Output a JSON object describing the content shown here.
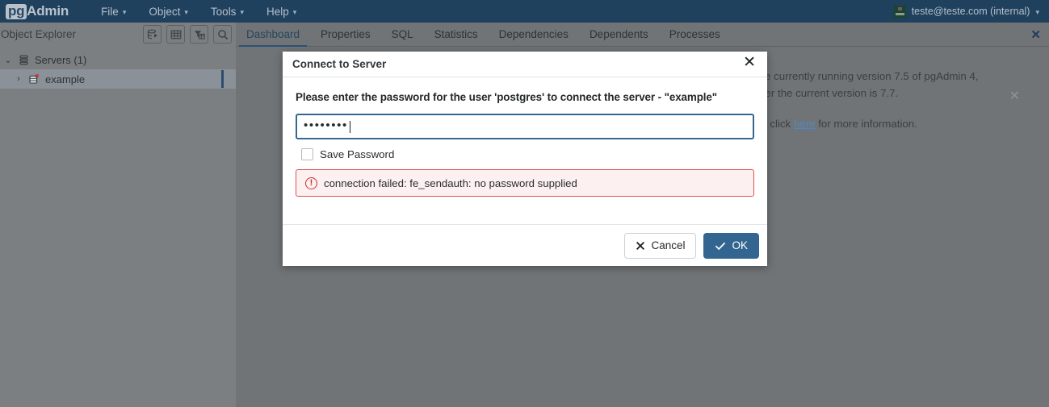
{
  "navbar": {
    "brand_pg": "pg",
    "brand_admin": "Admin",
    "menus": [
      {
        "label": "File",
        "icon": "chevron-down-icon"
      },
      {
        "label": "Object",
        "icon": "chevron-down-icon"
      },
      {
        "label": "Tools",
        "icon": "chevron-down-icon"
      },
      {
        "label": "Help",
        "icon": "chevron-down-icon"
      }
    ],
    "user": "teste@teste.com (internal)",
    "user_caret": "⌄"
  },
  "object_explorer": {
    "title": "Object Explorer",
    "tools": [
      {
        "name": "add-server-icon"
      },
      {
        "name": "table-grid-icon"
      },
      {
        "name": "filter-table-icon"
      },
      {
        "name": "search-icon"
      }
    ],
    "tree": [
      {
        "label": "Servers (1)",
        "chevron": "⌄",
        "icon": "servers-icon",
        "selected": false
      },
      {
        "label": "example",
        "chevron": "›",
        "icon": "server-disconnected-icon",
        "selected": true
      }
    ]
  },
  "tabs": {
    "items": [
      {
        "label": "Dashboard",
        "active": true
      },
      {
        "label": "Properties",
        "active": false
      },
      {
        "label": "SQL",
        "active": false
      },
      {
        "label": "Statistics",
        "active": false
      },
      {
        "label": "Dependencies",
        "active": false
      },
      {
        "label": "Dependents",
        "active": false
      },
      {
        "label": "Processes",
        "active": false
      }
    ],
    "close_label": "✕"
  },
  "notification": {
    "line1": "You are currently running version 7.5 of pgAdmin 4, however the current version is 7.7.",
    "line2_prefix": "Please click ",
    "link": "here",
    "line2_suffix": " for more information.",
    "close_label": "✕",
    "ghost_label": "Dashboard"
  },
  "dialog": {
    "title": "Connect to Server",
    "close_label": "✕",
    "message": "Please enter the password for the user 'postgres' to connect the server - \"example\"",
    "password_value": "••••••••",
    "password_placeholder": "",
    "save_password_label": "Save Password",
    "save_password_checked": false,
    "error_icon": "!",
    "error_text": "connection failed: fe_sendauth: no password supplied",
    "cancel_label": "Cancel",
    "ok_label": "OK"
  },
  "colors": {
    "navbar_bg": "#20415e",
    "accent": "#326690",
    "error_border": "#d9534f",
    "error_bg": "#fcf0f0",
    "link": "#4e87c7",
    "overlay_left": "#7c7f81",
    "overlay_main": "#717476"
  }
}
